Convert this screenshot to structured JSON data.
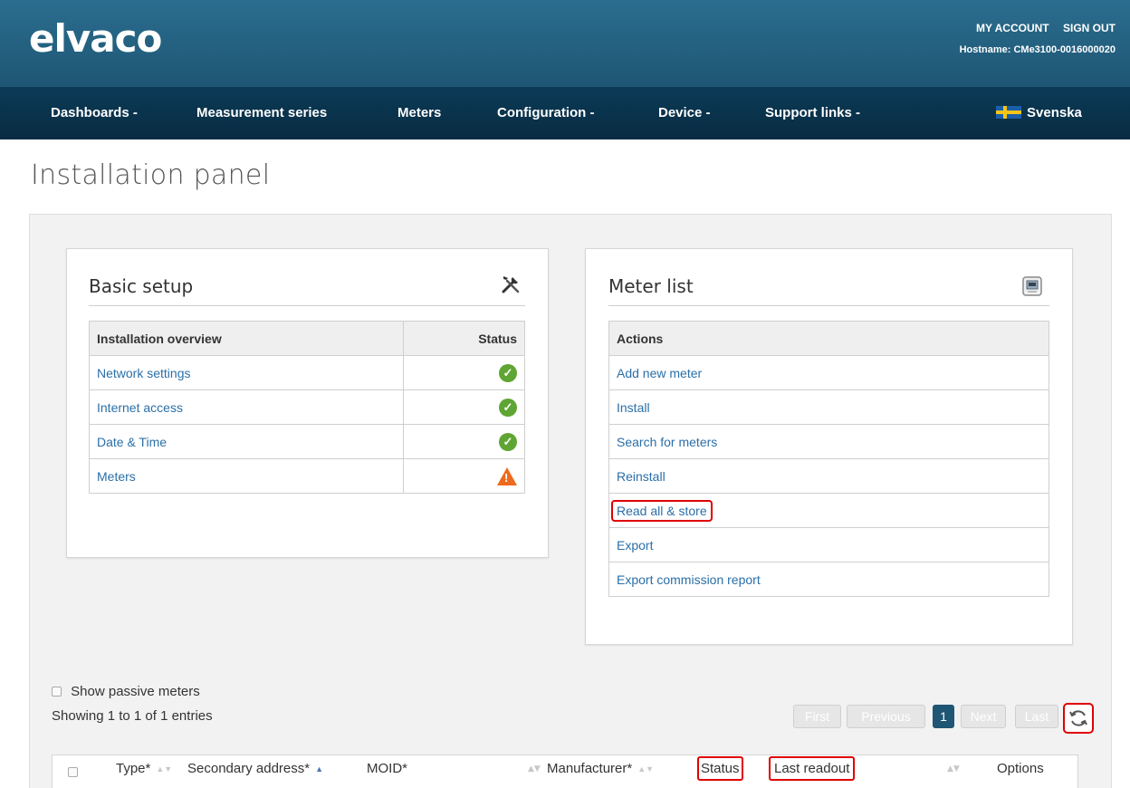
{
  "brand": {
    "logo": "elvaco"
  },
  "header": {
    "account_label": "MY ACCOUNT",
    "signout_label": "SIGN OUT",
    "hostname": "Hostname: CMe3100-0016000020"
  },
  "nav": {
    "items": [
      {
        "label": "Dashboards -"
      },
      {
        "label": "Measurement series"
      },
      {
        "label": "Meters"
      },
      {
        "label": "Configuration -"
      },
      {
        "label": "Device -"
      },
      {
        "label": "Support links -"
      }
    ],
    "language": "Svenska"
  },
  "page": {
    "title": "Installation panel"
  },
  "basic_setup": {
    "title": "Basic setup",
    "icon": "tools-icon",
    "col_overview": "Installation overview",
    "col_status": "Status",
    "rows": [
      {
        "label": "Network settings",
        "status": "ok"
      },
      {
        "label": "Internet access",
        "status": "ok"
      },
      {
        "label": "Date & Time",
        "status": "ok"
      },
      {
        "label": "Meters",
        "status": "warning"
      }
    ]
  },
  "meter_list": {
    "title": "Meter list",
    "icon": "meter-icon",
    "col_actions": "Actions",
    "actions": [
      {
        "label": "Add new meter"
      },
      {
        "label": "Install"
      },
      {
        "label": "Search for meters"
      },
      {
        "label": "Reinstall"
      },
      {
        "label": "Read all & store"
      },
      {
        "label": "Export"
      },
      {
        "label": "Export commission report"
      }
    ]
  },
  "list": {
    "show_passive_label": "Show passive meters",
    "entries_info": "Showing 1 to 1 of 1 entries",
    "pager": {
      "first": "First",
      "previous": "Previous",
      "current": "1",
      "next": "Next",
      "last": "Last"
    },
    "columns": {
      "type": "Type*",
      "secondary_address": "Secondary address*",
      "moid": "MOID*",
      "manufacturer": "Manufacturer*",
      "status": "Status",
      "last_readout": "Last readout",
      "options": "Options"
    }
  },
  "colors": {
    "header": "#1e5674",
    "nav": "#0c3b57",
    "link": "#2a6fa8",
    "ok": "#5fa533",
    "warning": "#ee6a1c",
    "highlight": "#e00000"
  }
}
